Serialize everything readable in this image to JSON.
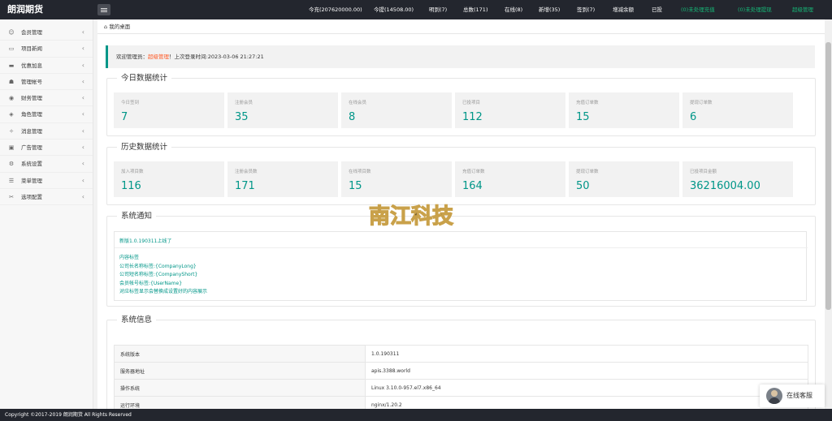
{
  "app": {
    "title": "朗润期货"
  },
  "topbar": {
    "stats": [
      {
        "label": "今充(207620000.00)",
        "color": ""
      },
      {
        "label": "今提(14508.00)",
        "color": ""
      },
      {
        "label": "明到(7)",
        "color": ""
      },
      {
        "label": "总数(171)",
        "color": ""
      },
      {
        "label": "在线(8)",
        "color": ""
      },
      {
        "label": "新增(35)",
        "color": ""
      },
      {
        "label": "签到(7)",
        "color": ""
      },
      {
        "label": "增减余额",
        "color": ""
      },
      {
        "label": "已投",
        "color": ""
      },
      {
        "label": "(0)未处理充值",
        "color": "green"
      },
      {
        "label": "(0)未处理提现",
        "color": "green"
      },
      {
        "label": "超级管理",
        "color": "green"
      }
    ]
  },
  "sidebar": {
    "items": [
      {
        "label": "会员管理",
        "icon": "user-icon"
      },
      {
        "label": "项目新闻",
        "icon": "book-icon"
      },
      {
        "label": "优惠加息",
        "icon": "card-icon"
      },
      {
        "label": "管理帐号",
        "icon": "admin-icon"
      },
      {
        "label": "财务管理",
        "icon": "finance-icon"
      },
      {
        "label": "角色管理",
        "icon": "shield-icon"
      },
      {
        "label": "消息管理",
        "icon": "message-icon"
      },
      {
        "label": "广告管理",
        "icon": "ad-icon"
      },
      {
        "label": "系统设置",
        "icon": "gear-icon"
      },
      {
        "label": "菜单管理",
        "icon": "menu-icon"
      },
      {
        "label": "选项配置",
        "icon": "config-icon"
      }
    ]
  },
  "tab": {
    "label": "我的桌面"
  },
  "welcome": {
    "prefix": "欢迎管理员：",
    "role": "超级管理",
    "suffix": "！上次登录时间:2023-03-06 21:27:21"
  },
  "today": {
    "title": "今日数据统计",
    "cards": [
      {
        "label": "今日签到",
        "value": "7"
      },
      {
        "label": "注册会员",
        "value": "35"
      },
      {
        "label": "在线会员",
        "value": "8"
      },
      {
        "label": "已投项目",
        "value": "112"
      },
      {
        "label": "充值订单数",
        "value": "15"
      },
      {
        "label": "提现订单数",
        "value": "6"
      }
    ]
  },
  "history": {
    "title": "历史数据统计",
    "cards": [
      {
        "label": "加入项目数",
        "value": "116"
      },
      {
        "label": "注册会员数",
        "value": "171"
      },
      {
        "label": "在线项目数",
        "value": "15"
      },
      {
        "label": "充值订单数",
        "value": "164"
      },
      {
        "label": "提现订单数",
        "value": "50"
      },
      {
        "label": "已投项目金额",
        "value": "36216004.00"
      }
    ]
  },
  "notice": {
    "title": "系统通知",
    "headline": "新版1.0.190311上线了",
    "lines": [
      "内容标签",
      "公司长名称标签:{CompanyLong}",
      "公司短名称标签:{CompanyShort}",
      "会员帐号标签:{UserName}",
      "对应标签显示会替换成设置好的内容展示"
    ]
  },
  "sysinfo": {
    "title": "系统信息",
    "rows": [
      {
        "key": "系统版本",
        "value": "1.0.190311"
      },
      {
        "key": "服务器地址",
        "value": "apis.3388.world"
      },
      {
        "key": "操作系统",
        "value": "Linux 3.10.0-957.el7.x86_64"
      },
      {
        "key": "运行环境",
        "value": "nginx/1.20.2"
      }
    ]
  },
  "footer": {
    "text": "Copyright ©2017-2019 朗润期货 All Rights Reserved"
  },
  "service": {
    "label": "在线客服"
  },
  "watermark": {
    "text": "南江科技"
  }
}
